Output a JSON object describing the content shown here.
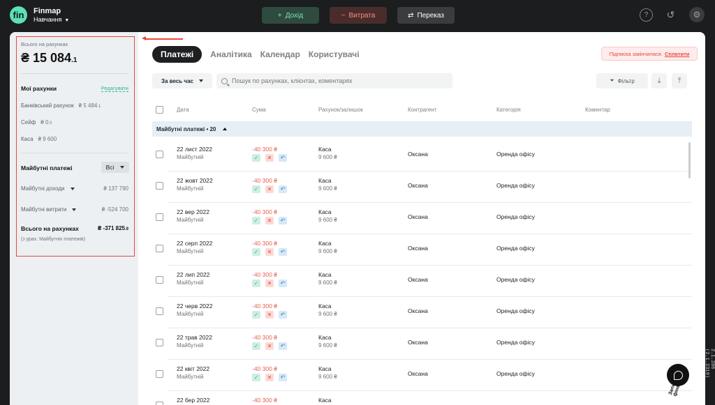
{
  "app": {
    "logo": "fin",
    "name": "Finmap",
    "workspace": "Навчання"
  },
  "header": {
    "income_label": "Дохід",
    "expense_label": "Витрата",
    "transfer_label": "Переказ",
    "icons": [
      "help-icon",
      "history-icon",
      "settings-icon"
    ]
  },
  "sidebar": {
    "total_label": "Всього на рахунках",
    "total_value": "₴ 15 084",
    "total_decimal": ".1",
    "accounts_title": "Мої рахунки",
    "edit_label": "Редагувати",
    "accounts": [
      {
        "name": "Банківський рахунок",
        "amount": "₴ 5 484",
        "decimal": ".1"
      },
      {
        "name": "Сейф",
        "amount": "₴ 0",
        "decimal": ".0"
      },
      {
        "name": "Каса",
        "amount": "₴ 9 600",
        "decimal": ""
      }
    ],
    "future_title": "Майбутні платежі",
    "future_filter": "Всі",
    "future_income_label": "Майбутні доходи",
    "future_income_value": "₴ 137 790",
    "future_expense_label": "Майбутні витрати",
    "future_expense_value": "₴ -524 700",
    "grand_total_label": "Всього на рахунках",
    "grand_total_value": "₴ -371 825",
    "grand_total_decimal": ".9",
    "grand_total_note": "(з урах. Майбутніх платежів)"
  },
  "tabs": [
    "Платежі",
    "Аналітика",
    "Календар",
    "Користувачі"
  ],
  "subscription": {
    "text": "Підписка закінчилася.",
    "link": "Сплатити"
  },
  "toolbar": {
    "period": "За весь час",
    "search_placeholder": "Пошук по рахунках, клієнтах, коментарях",
    "filter_label": "Фільтр"
  },
  "table": {
    "columns": [
      "Дата",
      "Сума",
      "Рахунок/залишок",
      "Контрагент",
      "Категорія",
      "Коментар"
    ],
    "group_label": "Майбутні платежі • 20",
    "rows": [
      {
        "date": "22 лист 2022",
        "status": "Майбутній",
        "sum": "-40 300 ₴",
        "account": "Каса",
        "balance": "9 600 ₴",
        "counterparty": "Оксана",
        "category": "Оренда офісу"
      },
      {
        "date": "22 жовт 2022",
        "status": "Майбутній",
        "sum": "-40 300 ₴",
        "account": "Каса",
        "balance": "9 600 ₴",
        "counterparty": "Оксана",
        "category": "Оренда офісу"
      },
      {
        "date": "22 вер 2022",
        "status": "Майбутній",
        "sum": "-40 300 ₴",
        "account": "Каса",
        "balance": "9 600 ₴",
        "counterparty": "Оксана",
        "category": "Оренда офісу"
      },
      {
        "date": "22 серп 2022",
        "status": "Майбутній",
        "sum": "-40 300 ₴",
        "account": "Каса",
        "balance": "9 600 ₴",
        "counterparty": "Оксана",
        "category": "Оренда офісу"
      },
      {
        "date": "22 лип 2022",
        "status": "Майбутній",
        "sum": "-40 300 ₴",
        "account": "Каса",
        "balance": "9 600 ₴",
        "counterparty": "Оксана",
        "category": "Оренда офісу"
      },
      {
        "date": "22 черв 2022",
        "status": "Майбутній",
        "sum": "-40 300 ₴",
        "account": "Каса",
        "balance": "9 600 ₴",
        "counterparty": "Оксана",
        "category": "Оренда офісу"
      },
      {
        "date": "22 трав 2022",
        "status": "Майбутній",
        "sum": "-40 300 ₴",
        "account": "Каса",
        "balance": "9 600 ₴",
        "counterparty": "Оксана",
        "category": "Оренда офісу"
      },
      {
        "date": "22 квіт 2022",
        "status": "Майбутній",
        "sum": "-40 300 ₴",
        "account": "Каса",
        "balance": "9 600 ₴",
        "counterparty": "Оксана",
        "category": "Оренда офісу"
      },
      {
        "date": "22 бер 2022",
        "status": "",
        "sum": "-40 300 ₴",
        "account": "Каса",
        "balance": "",
        "counterparty": "",
        "category": ""
      }
    ]
  },
  "chat": {
    "label": "Запитати фінансиста"
  },
  "version": "2.1.286 (2.1.2319)"
}
